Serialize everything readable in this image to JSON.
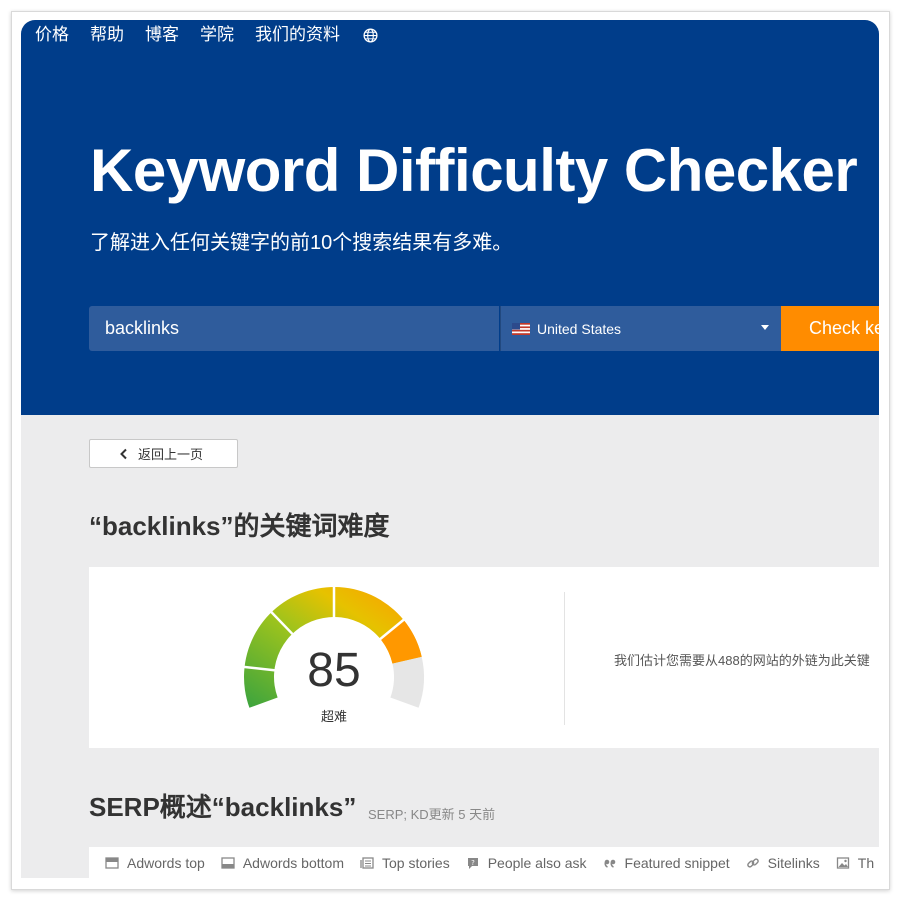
{
  "nav": {
    "links": [
      "价格",
      "帮助",
      "博客",
      "学院",
      "我们的资料"
    ]
  },
  "hero": {
    "title": "Keyword Difficulty Checker",
    "subtitle": "了解进入任何关键字的前10个搜索结果有多难。"
  },
  "search": {
    "keyword_value": "backlinks",
    "country": "United States",
    "submit_label": "Check ke"
  },
  "back_button_label": "返回上一页",
  "difficulty": {
    "heading": "“backlinks”的关键词难度",
    "score": "85",
    "level": "超难",
    "score_fraction": 0.85,
    "note": "我们估计您需要从488的网站的外链为此关键"
  },
  "serp": {
    "heading": "SERP概述“backlinks”",
    "meta": "SERP; KD更新 5 天前",
    "tabs": [
      "Adwords top",
      "Adwords bottom",
      "Top stories",
      "People also ask",
      "Featured snippet",
      "Sitelinks",
      "Th"
    ]
  },
  "colors": {
    "hero_bg": "#003d8a",
    "accent_orange": "#ff8c00",
    "gauge_green": "#3aa33f",
    "gauge_yellow": "#e6c200",
    "gauge_orange": "#ff9800",
    "gauge_empty": "#e6e6e6"
  },
  "icons": {
    "globe": "globe-icon",
    "flag": "us-flag-icon",
    "back": "chevron-left-icon",
    "tabs": [
      "ad-top-icon",
      "ad-bottom-icon",
      "news-icon",
      "question-icon",
      "quote-icon",
      "link-icon",
      "image-icon"
    ]
  }
}
